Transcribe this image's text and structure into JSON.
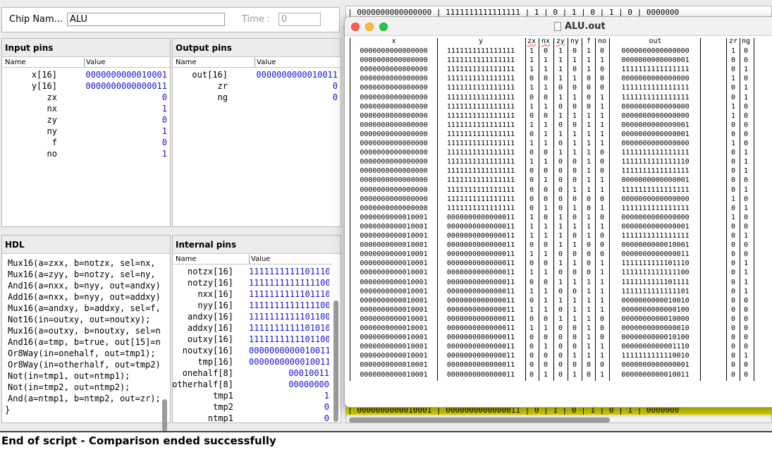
{
  "chip": {
    "label": "Chip Nam...",
    "value": "ALU",
    "time_label": "Time :",
    "time_value": "0"
  },
  "input_pins": {
    "title": "Input pins",
    "col_name": "Name",
    "col_value": "Value",
    "rows": [
      {
        "name": "x[16]",
        "value": "0000000000010001"
      },
      {
        "name": "y[16]",
        "value": "0000000000000011"
      },
      {
        "name": "zx",
        "value": "0"
      },
      {
        "name": "nx",
        "value": "1"
      },
      {
        "name": "zy",
        "value": "0"
      },
      {
        "name": "ny",
        "value": "1"
      },
      {
        "name": "f",
        "value": "0"
      },
      {
        "name": "no",
        "value": "1"
      }
    ]
  },
  "output_pins": {
    "title": "Output pins",
    "col_name": "Name",
    "col_value": "Value",
    "rows": [
      {
        "name": "out[16]",
        "value": "0000000000010011"
      },
      {
        "name": "zr",
        "value": "0"
      },
      {
        "name": "ng",
        "value": "0"
      }
    ]
  },
  "hdl": {
    "title": "HDL",
    "lines": [
      "Mux16(a=zxx, b=notzx, sel=nx, o",
      "Mux16(a=zyy, b=notzy, sel=ny, o",
      "And16(a=nxx, b=nyy, out=andxy);",
      "Add16(a=nxx, b=nyy, out=addxy);",
      "Mux16(a=andxy, b=addxy, sel=f, ",
      "Not16(in=outxy, out=noutxy);",
      "Mux16(a=outxy, b=noutxy, sel=no",
      "And16(a=tmp, b=true, out[15]=ng",
      "Or8Way(in=onehalf, out=tmp1);",
      "Or8Way(in=otherhalf, out=tmp2);",
      "Not(in=tmp1, out=ntmp1);",
      "Not(in=tmp2, out=ntmp2);",
      "And(a=ntmp1, b=ntmp2, out=zr);",
      "}"
    ]
  },
  "internal_pins": {
    "title": "Internal pins",
    "col_name": "Name",
    "col_value": "Value",
    "rows": [
      {
        "name": "notzx[16]",
        "value": "1111111111101110"
      },
      {
        "name": "notzy[16]",
        "value": "1111111111111100"
      },
      {
        "name": "nxx[16]",
        "value": "1111111111101110"
      },
      {
        "name": "nyy[16]",
        "value": "1111111111111100"
      },
      {
        "name": "andxy[16]",
        "value": "1111111111101100"
      },
      {
        "name": "addxy[16]",
        "value": "1111111111101010"
      },
      {
        "name": "outxy[16]",
        "value": "1111111111101100"
      },
      {
        "name": "noutxy[16]",
        "value": "0000000000010011"
      },
      {
        "name": "tmp[16]",
        "value": "0000000000010011"
      },
      {
        "name": "onehalf[8]",
        "value": "00010011"
      },
      {
        "name": "otherhalf[8]",
        "value": "00000000"
      },
      {
        "name": "tmp1",
        "value": "1"
      },
      {
        "name": "tmp2",
        "value": "0"
      },
      {
        "name": "ntmp1",
        "value": "0"
      }
    ]
  },
  "compare_top_row": "| 0000000000000000 | 1111111111111111 | 1 | 0 | 1 | 0 | 1 | 0 | 0000000",
  "compare_bottom_row": "| 0000000000010001 | 0000000000000011 | 0 | 1 | 0 | 1 | 0 | 1 | 0000000",
  "status": "End of script - Comparison ended successfully",
  "out_window": {
    "title": "ALU.out",
    "headers": [
      "x",
      "y",
      "zx",
      "nx",
      "zy",
      "ny",
      "f",
      "no",
      "out",
      "zr",
      "ng"
    ],
    "rows": [
      [
        "0000000000000000",
        "1111111111111111",
        "1",
        "0",
        "1",
        "0",
        "1",
        "0",
        "0000000000000000",
        "1",
        "0"
      ],
      [
        "0000000000000000",
        "1111111111111111",
        "1",
        "1",
        "1",
        "1",
        "1",
        "1",
        "0000000000000001",
        "0",
        "0"
      ],
      [
        "0000000000000000",
        "1111111111111111",
        "1",
        "1",
        "1",
        "0",
        "1",
        "0",
        "1111111111111111",
        "0",
        "1"
      ],
      [
        "0000000000000000",
        "1111111111111111",
        "0",
        "0",
        "1",
        "1",
        "0",
        "0",
        "0000000000000000",
        "1",
        "0"
      ],
      [
        "0000000000000000",
        "1111111111111111",
        "1",
        "1",
        "0",
        "0",
        "0",
        "0",
        "1111111111111111",
        "0",
        "1"
      ],
      [
        "0000000000000000",
        "1111111111111111",
        "0",
        "0",
        "1",
        "1",
        "0",
        "1",
        "1111111111111111",
        "0",
        "1"
      ],
      [
        "0000000000000000",
        "1111111111111111",
        "1",
        "1",
        "0",
        "0",
        "0",
        "1",
        "0000000000000000",
        "1",
        "0"
      ],
      [
        "0000000000000000",
        "1111111111111111",
        "0",
        "0",
        "1",
        "1",
        "1",
        "1",
        "0000000000000000",
        "1",
        "0"
      ],
      [
        "0000000000000000",
        "1111111111111111",
        "1",
        "1",
        "0",
        "0",
        "1",
        "1",
        "0000000000000001",
        "0",
        "0"
      ],
      [
        "0000000000000000",
        "1111111111111111",
        "0",
        "1",
        "1",
        "1",
        "1",
        "1",
        "0000000000000001",
        "0",
        "0"
      ],
      [
        "0000000000000000",
        "1111111111111111",
        "1",
        "1",
        "0",
        "1",
        "1",
        "1",
        "0000000000000000",
        "1",
        "0"
      ],
      [
        "0000000000000000",
        "1111111111111111",
        "0",
        "0",
        "1",
        "1",
        "1",
        "0",
        "1111111111111111",
        "0",
        "1"
      ],
      [
        "0000000000000000",
        "1111111111111111",
        "1",
        "1",
        "0",
        "0",
        "1",
        "0",
        "1111111111111110",
        "0",
        "1"
      ],
      [
        "0000000000000000",
        "1111111111111111",
        "0",
        "0",
        "0",
        "0",
        "1",
        "0",
        "1111111111111111",
        "0",
        "1"
      ],
      [
        "0000000000000000",
        "1111111111111111",
        "0",
        "1",
        "0",
        "0",
        "1",
        "1",
        "0000000000000001",
        "0",
        "0"
      ],
      [
        "0000000000000000",
        "1111111111111111",
        "0",
        "0",
        "0",
        "1",
        "1",
        "1",
        "1111111111111111",
        "0",
        "1"
      ],
      [
        "0000000000000000",
        "1111111111111111",
        "0",
        "0",
        "0",
        "0",
        "0",
        "0",
        "0000000000000000",
        "1",
        "0"
      ],
      [
        "0000000000000000",
        "1111111111111111",
        "0",
        "1",
        "0",
        "1",
        "0",
        "1",
        "1111111111111111",
        "0",
        "1"
      ],
      [
        "0000000000010001",
        "0000000000000011",
        "1",
        "0",
        "1",
        "0",
        "1",
        "0",
        "0000000000000000",
        "1",
        "0"
      ],
      [
        "0000000000010001",
        "0000000000000011",
        "1",
        "1",
        "1",
        "1",
        "1",
        "1",
        "0000000000000001",
        "0",
        "0"
      ],
      [
        "0000000000010001",
        "0000000000000011",
        "1",
        "1",
        "1",
        "0",
        "1",
        "0",
        "1111111111111111",
        "0",
        "1"
      ],
      [
        "0000000000010001",
        "0000000000000011",
        "0",
        "0",
        "1",
        "1",
        "0",
        "0",
        "0000000000010001",
        "0",
        "0"
      ],
      [
        "0000000000010001",
        "0000000000000011",
        "1",
        "1",
        "0",
        "0",
        "0",
        "0",
        "0000000000000011",
        "0",
        "0"
      ],
      [
        "0000000000010001",
        "0000000000000011",
        "0",
        "0",
        "1",
        "1",
        "0",
        "1",
        "1111111111101110",
        "0",
        "1"
      ],
      [
        "0000000000010001",
        "0000000000000011",
        "1",
        "1",
        "0",
        "0",
        "0",
        "1",
        "1111111111111100",
        "0",
        "1"
      ],
      [
        "0000000000010001",
        "0000000000000011",
        "0",
        "0",
        "1",
        "1",
        "1",
        "1",
        "1111111111101111",
        "0",
        "1"
      ],
      [
        "0000000000010001",
        "0000000000000011",
        "1",
        "1",
        "0",
        "0",
        "1",
        "1",
        "1111111111111101",
        "0",
        "1"
      ],
      [
        "0000000000010001",
        "0000000000000011",
        "0",
        "1",
        "1",
        "1",
        "1",
        "1",
        "0000000000010010",
        "0",
        "0"
      ],
      [
        "0000000000010001",
        "0000000000000011",
        "1",
        "1",
        "0",
        "1",
        "1",
        "1",
        "0000000000000100",
        "0",
        "0"
      ],
      [
        "0000000000010001",
        "0000000000000011",
        "0",
        "0",
        "1",
        "1",
        "1",
        "0",
        "0000000000010000",
        "0",
        "0"
      ],
      [
        "0000000000010001",
        "0000000000000011",
        "1",
        "1",
        "0",
        "0",
        "1",
        "0",
        "0000000000000010",
        "0",
        "0"
      ],
      [
        "0000000000010001",
        "0000000000000011",
        "0",
        "0",
        "0",
        "0",
        "1",
        "0",
        "0000000000010100",
        "0",
        "0"
      ],
      [
        "0000000000010001",
        "0000000000000011",
        "0",
        "1",
        "0",
        "0",
        "1",
        "1",
        "0000000000001110",
        "0",
        "0"
      ],
      [
        "0000000000010001",
        "0000000000000011",
        "0",
        "0",
        "0",
        "1",
        "1",
        "1",
        "1111111111110010",
        "0",
        "1"
      ],
      [
        "0000000000010001",
        "0000000000000011",
        "0",
        "0",
        "0",
        "0",
        "0",
        "0",
        "0000000000000001",
        "0",
        "0"
      ],
      [
        "0000000000010001",
        "0000000000000011",
        "0",
        "1",
        "0",
        "1",
        "0",
        "1",
        "0000000000010011",
        "0",
        "0"
      ]
    ]
  },
  "colors": {
    "value_blue": "#1414d8",
    "compare_yellow": "#d9d400",
    "close": "#fe5f57",
    "minimize": "#febc2e",
    "zoom": "#28c840"
  }
}
